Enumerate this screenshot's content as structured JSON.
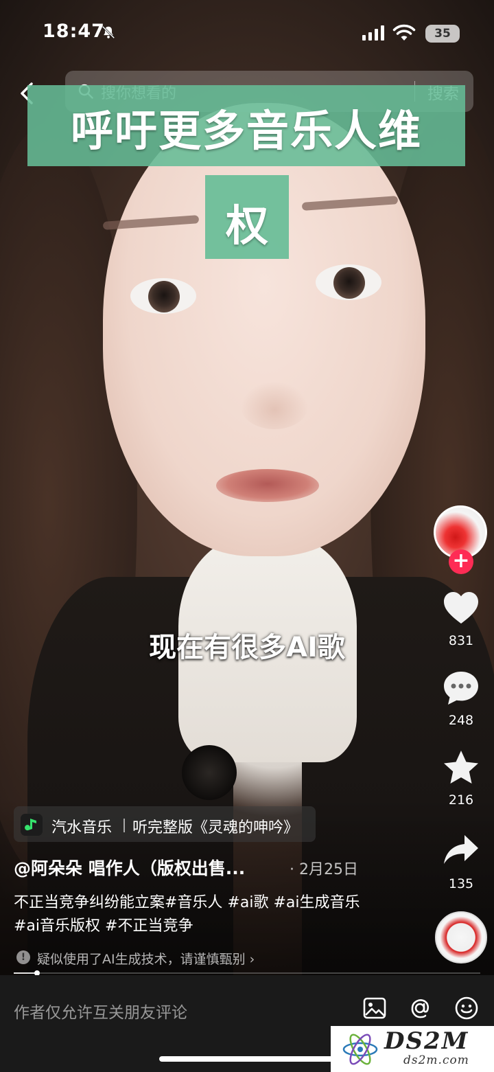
{
  "status_bar": {
    "time": "18:47",
    "battery": "35"
  },
  "search": {
    "placeholder": "搜你想看的",
    "button_label": "搜索"
  },
  "video": {
    "title_line1": "呼吁更多音乐人维",
    "title_line2": "权",
    "subtitle": "现在有很多AI歌"
  },
  "actions": {
    "likes": "831",
    "comments": "248",
    "favorites": "216",
    "shares": "135",
    "follow_symbol": "+"
  },
  "music": {
    "app_name": "汽水音乐",
    "track": "听完整版《灵魂的呻吟》"
  },
  "post": {
    "author": "@阿朵朵 唱作人（版权出售...",
    "date": "· 2月25日",
    "caption_line1": "不正当竞争纠纷能立案#音乐人 #ai歌 #ai生成音乐",
    "caption_line2": "#ai音乐版权 #不正当竞争",
    "ai_notice": "疑似使用了AI生成技术，请谨慎甄别 ›",
    "progress": 0.05
  },
  "comment_bar": {
    "placeholder": "作者仅允许互关朋友评论"
  },
  "watermark": {
    "brand": "DS2M",
    "site": "ds2m.com"
  },
  "colors": {
    "title_band": "#65bc96",
    "follow": "#fe2c55"
  }
}
